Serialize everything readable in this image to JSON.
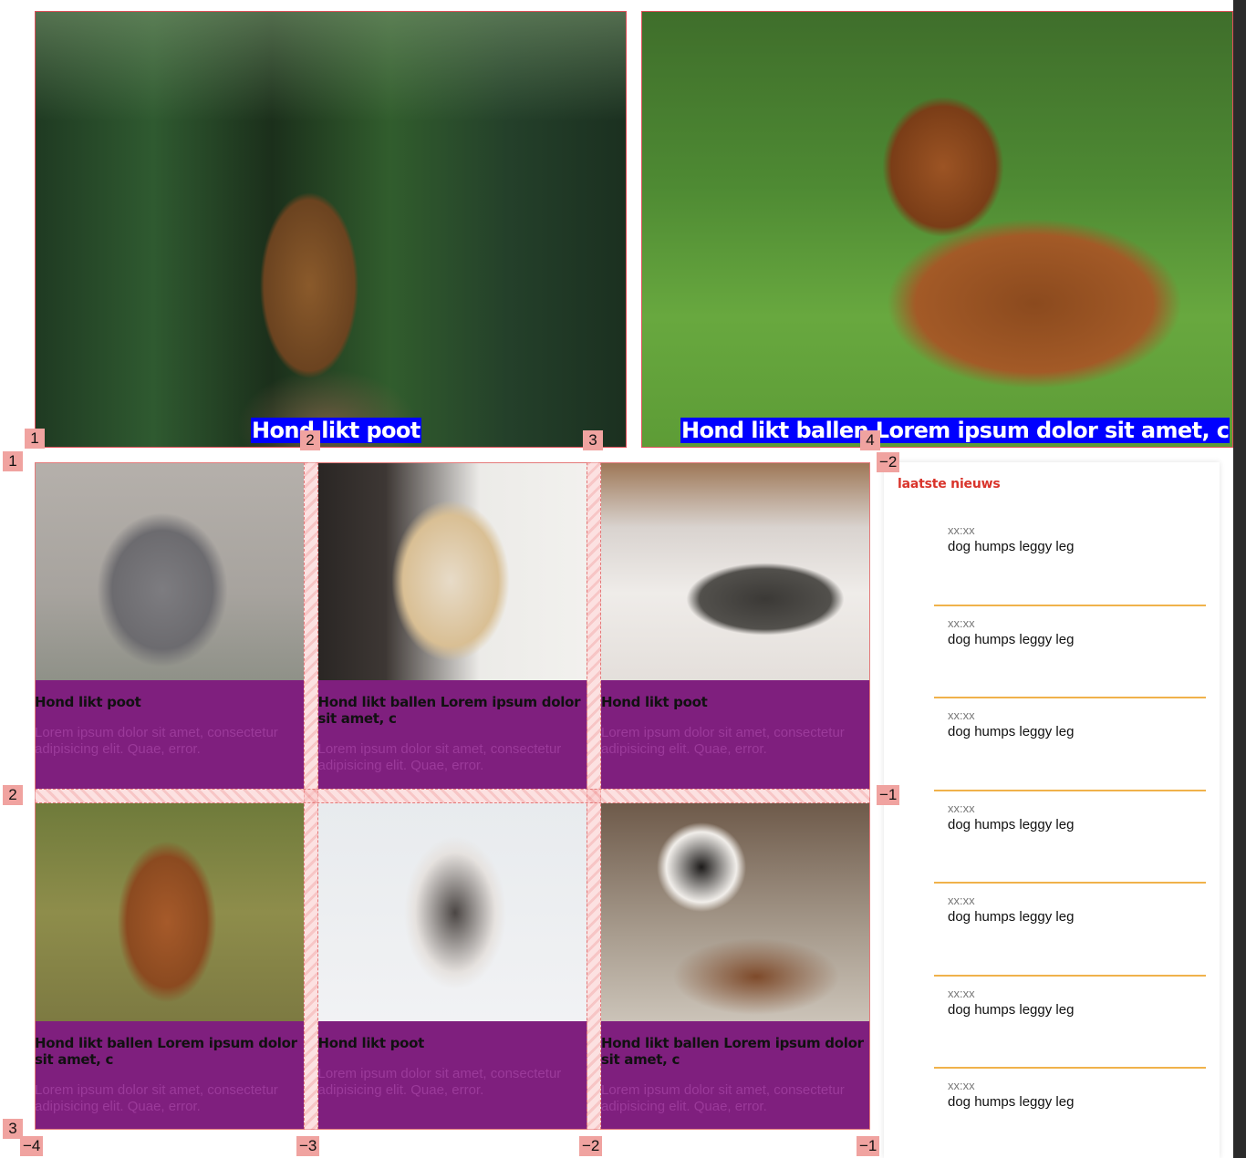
{
  "hero": [
    {
      "caption": "Hond likt poot"
    },
    {
      "caption": "Hond likt ballen Lorem ipsum dolor sit amet, c"
    }
  ],
  "cards": [
    {
      "title": "Hond likt poot",
      "text": "Lorem ipsum dolor sit amet, consectetur adipisicing elit. Quae, error."
    },
    {
      "title": "Hond likt ballen Lorem ipsum dolor sit amet, c",
      "text": "Lorem ipsum dolor sit amet, consectetur adipisicing elit. Quae, error."
    },
    {
      "title": "Hond likt poot",
      "text": "Lorem ipsum dolor sit amet, consectetur adipisicing elit. Quae, error."
    },
    {
      "title": "Hond likt ballen Lorem ipsum dolor sit amet, c",
      "text": "Lorem ipsum dolor sit amet, consectetur adipisicing elit. Quae, error."
    },
    {
      "title": "Hond likt poot",
      "text": "Lorem ipsum dolor sit amet, consectetur adipisicing elit. Quae, error."
    },
    {
      "title": "Hond likt ballen Lorem ipsum dolor sit amet, c",
      "text": "Lorem ipsum dolor sit amet, consectetur adipisicing elit. Quae, error."
    }
  ],
  "grid_labels": {
    "col_top": [
      "1",
      "2",
      "3",
      "4"
    ],
    "col_bottom": [
      "-4",
      "-3",
      "-2",
      "-1"
    ],
    "row_left": [
      "1",
      "2",
      "3"
    ],
    "row_right": [
      "-2",
      "-1"
    ]
  },
  "sidebar": {
    "title": "laatste nieuws",
    "items": [
      {
        "time": "xx:xx",
        "text": "dog humps leggy leg"
      },
      {
        "time": "xx:xx",
        "text": "dog humps leggy leg"
      },
      {
        "time": "xx:xx",
        "text": "dog humps leggy leg"
      },
      {
        "time": "xx:xx",
        "text": "dog humps leggy leg"
      },
      {
        "time": "xx:xx",
        "text": "dog humps leggy leg"
      },
      {
        "time": "xx:xx",
        "text": "dog humps leggy leg"
      },
      {
        "time": "xx:xx",
        "text": "dog humps leggy leg"
      }
    ]
  },
  "colors": {
    "card_bg": "#7f1f7e",
    "caption_bg": "#0000ff",
    "news_title": "#d9342b",
    "news_rule": "#f0b24b",
    "grid_overlay": "#e47979"
  }
}
